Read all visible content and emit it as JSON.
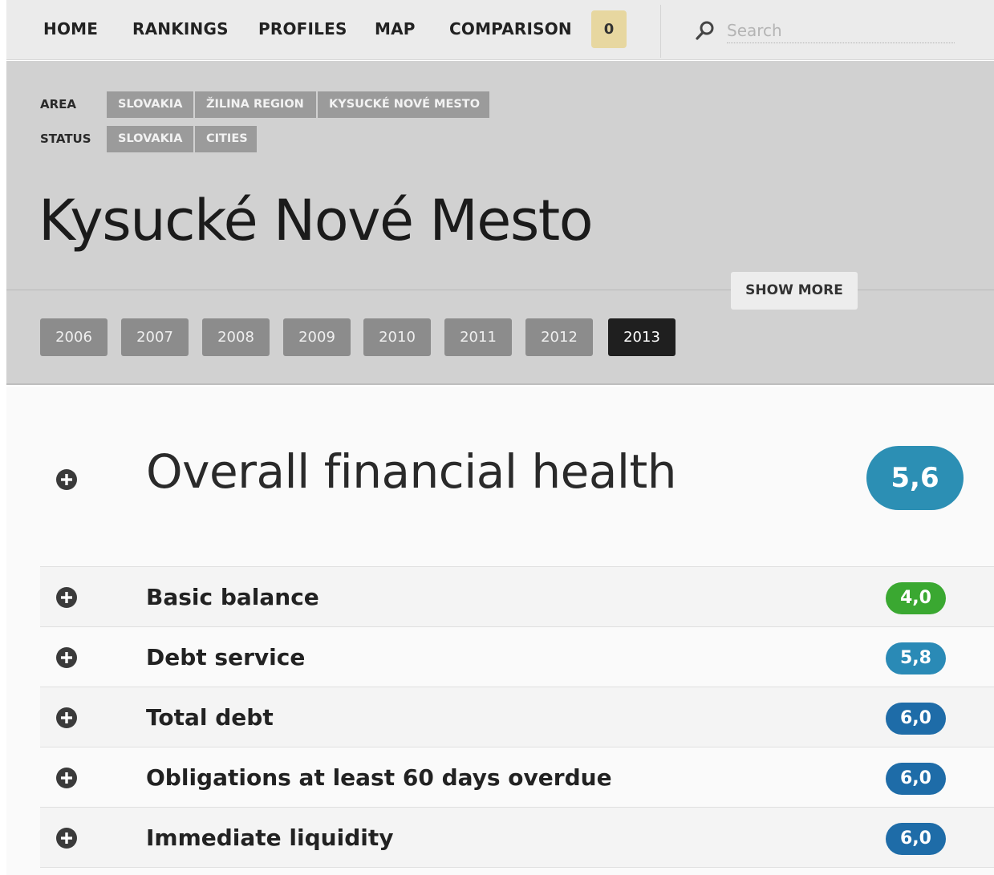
{
  "nav": {
    "items": [
      {
        "label": "HOME"
      },
      {
        "label": "RANKINGS"
      },
      {
        "label": "PROFILES"
      },
      {
        "label": "MAP"
      },
      {
        "label": "COMPARISON"
      }
    ],
    "comparison_count": "0",
    "search_placeholder": "Search",
    "search_value": ""
  },
  "header": {
    "area_label": "AREA",
    "area_crumbs": [
      "SLOVAKIA",
      "ŽILINA REGION",
      "KYSUCKÉ NOVÉ MESTO"
    ],
    "status_label": "STATUS",
    "status_crumbs": [
      "SLOVAKIA",
      "CITIES"
    ],
    "title": "Kysucké Nové Mesto",
    "show_more_label": "SHOW MORE",
    "years": [
      "2006",
      "2007",
      "2008",
      "2009",
      "2010",
      "2011",
      "2012",
      "2013"
    ],
    "active_year": "2013"
  },
  "overall": {
    "title": "Overall financial health",
    "score": "5,6",
    "score_color": "#2c8fb4"
  },
  "indicators": [
    {
      "label": "Basic balance",
      "score": "4,0",
      "color": "#3aa831"
    },
    {
      "label": "Debt service",
      "score": "5,8",
      "color": "#2a8ab6"
    },
    {
      "label": "Total debt",
      "score": "6,0",
      "color": "#1e6ca8"
    },
    {
      "label": "Obligations at least 60 days overdue",
      "score": "6,0",
      "color": "#1e6ca8"
    },
    {
      "label": "Immediate liquidity",
      "score": "6,0",
      "color": "#1e6ca8"
    }
  ],
  "icons": {
    "search": "search-icon",
    "expand": "plus-circle-icon"
  }
}
